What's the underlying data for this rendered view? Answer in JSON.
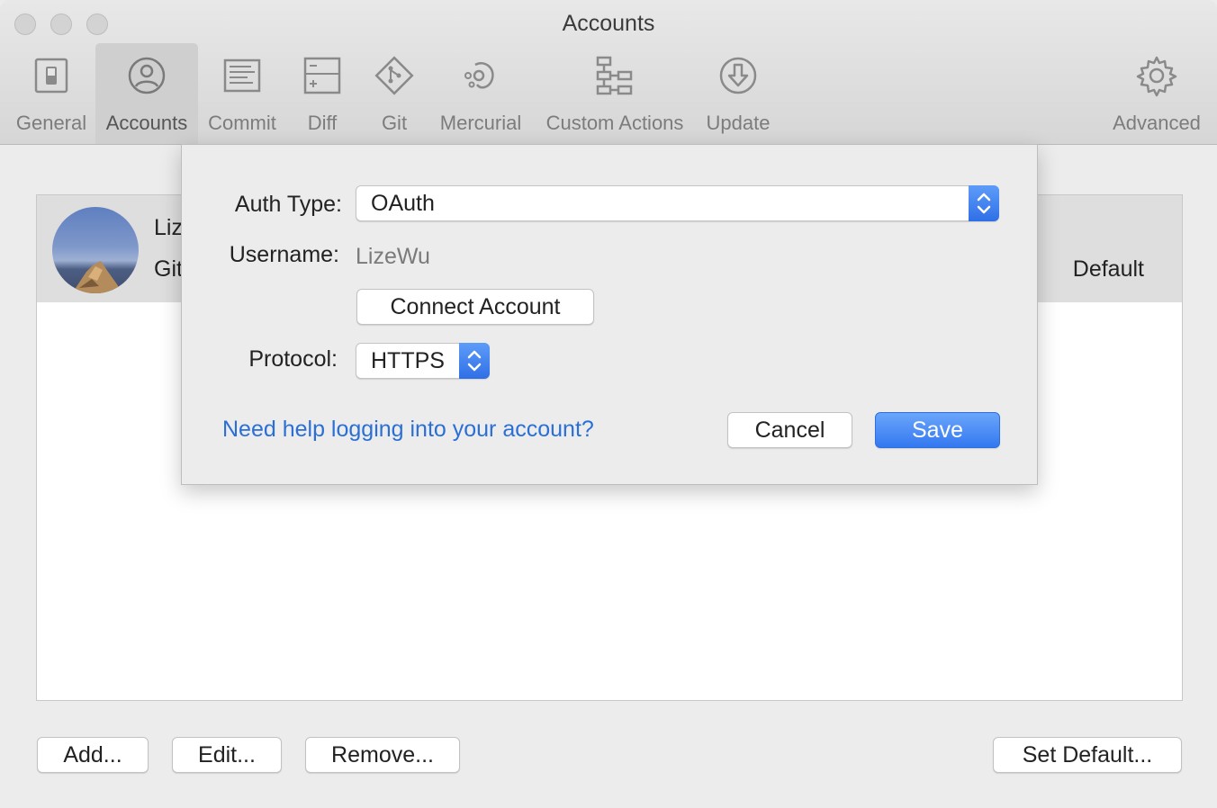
{
  "window": {
    "title": "Accounts"
  },
  "toolbar": {
    "items": [
      {
        "label": "General",
        "icon": "switch-icon"
      },
      {
        "label": "Accounts",
        "icon": "person-circle-icon",
        "selected": true
      },
      {
        "label": "Commit",
        "icon": "document-lines-icon"
      },
      {
        "label": "Diff",
        "icon": "diff-icon"
      },
      {
        "label": "Git",
        "icon": "git-diamond-icon"
      },
      {
        "label": "Mercurial",
        "icon": "mercurial-icon"
      },
      {
        "label": "Custom Actions",
        "icon": "flow-icon"
      },
      {
        "label": "Update",
        "icon": "download-circle-icon"
      },
      {
        "label": "Advanced",
        "icon": "gear-icon"
      }
    ]
  },
  "accounts": {
    "rows": [
      {
        "name": "Liz",
        "host": "Git",
        "status": "Default"
      }
    ]
  },
  "buttons": {
    "add": "Add...",
    "edit": "Edit...",
    "remove": "Remove...",
    "set_default": "Set Default..."
  },
  "sheet": {
    "auth_type_label": "Auth Type:",
    "auth_type_value": "OAuth",
    "username_label": "Username:",
    "username_value": "LizeWu",
    "connect_button": "Connect Account",
    "protocol_label": "Protocol:",
    "protocol_value": "HTTPS",
    "help_link": "Need help logging into your account?",
    "cancel_button": "Cancel",
    "save_button": "Save"
  },
  "colors": {
    "accent": "#3478f0",
    "link": "#2a6fd6",
    "selected_row": "#dedede"
  }
}
